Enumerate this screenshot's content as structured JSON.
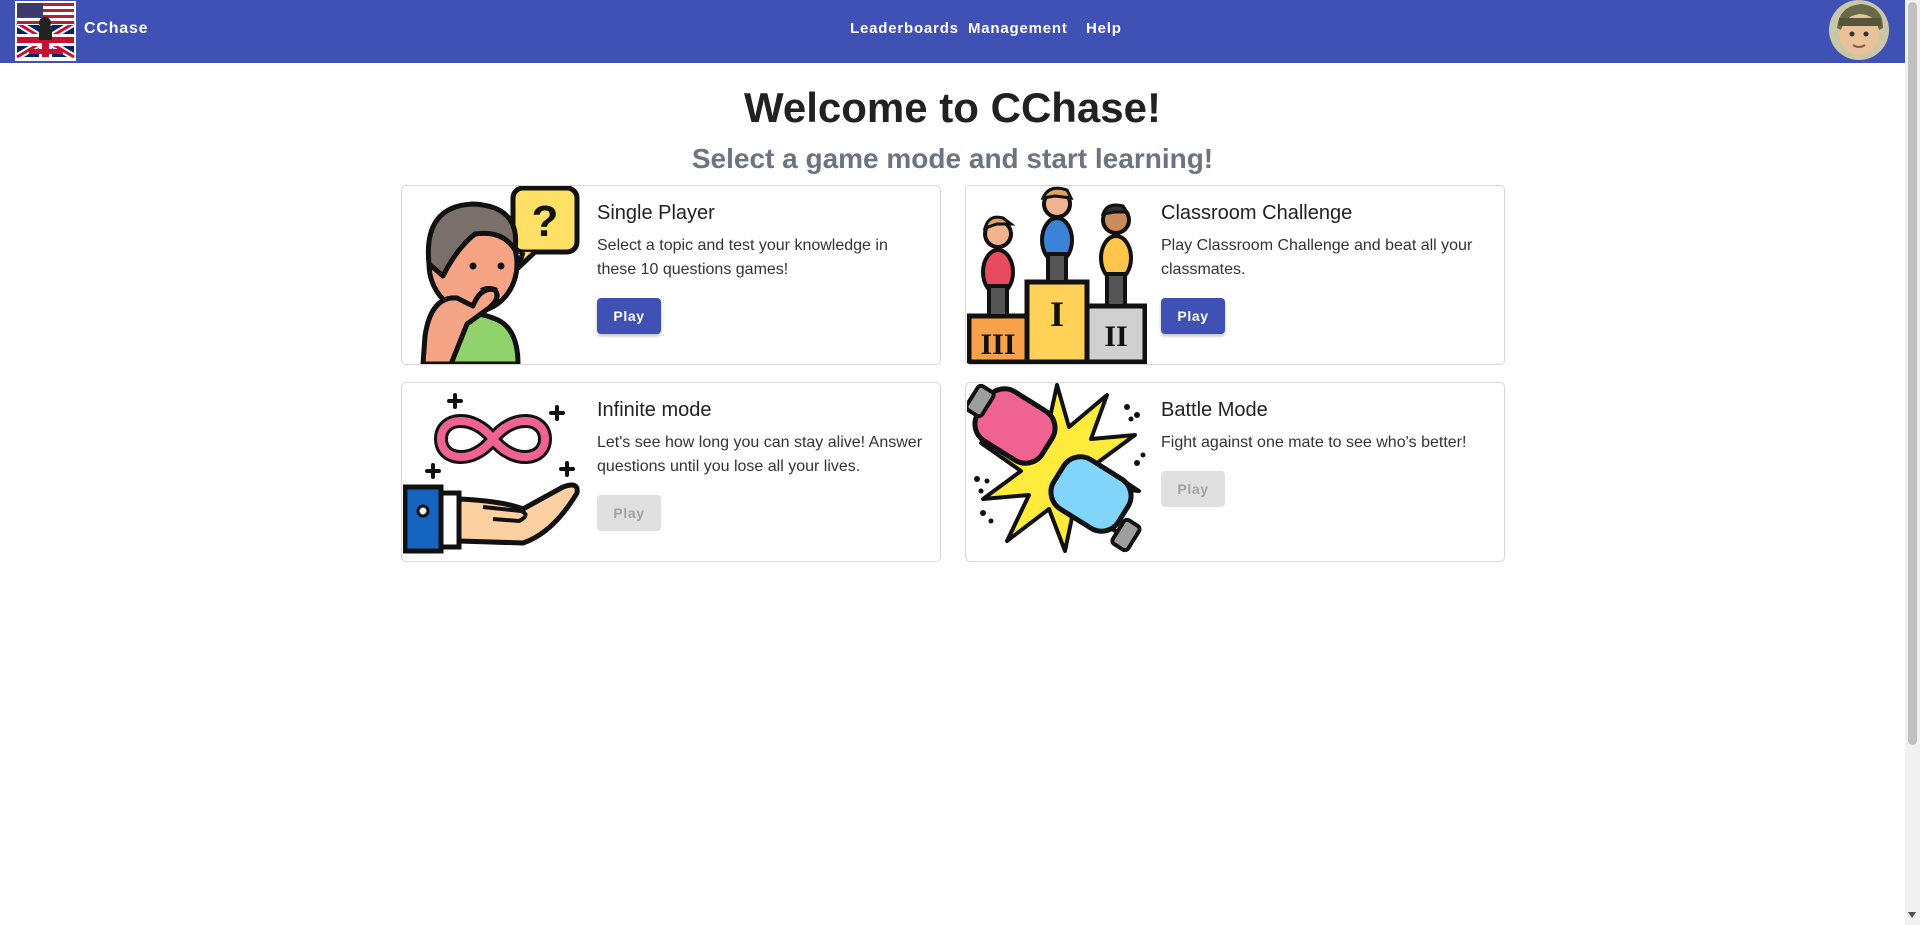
{
  "header": {
    "brand": "CChase",
    "logo_icon": "uk-us-flag-logo",
    "nav": [
      {
        "label": "Leaderboards"
      },
      {
        "label": "Management"
      },
      {
        "label": "Help"
      }
    ],
    "avatar_icon": "user-avatar",
    "colors": {
      "primary": "#3f51b5"
    }
  },
  "main": {
    "title": "Welcome to CChase!",
    "subtitle": "Select a game mode and start learning!"
  },
  "modes": [
    {
      "title": "Single Player",
      "description": "Select a topic and test your knowledge in these 10 questions games!",
      "button": "Play",
      "enabled": true,
      "icon": "thinking-boy-question-icon"
    },
    {
      "title": "Classroom Challenge",
      "description": "Play Classroom Challenge and beat all your classmates.",
      "button": "Play",
      "enabled": true,
      "icon": "podium-icon"
    },
    {
      "title": "Infinite mode",
      "description": "Let's see how long you can stay alive! Answer questions until you lose all your lives.",
      "button": "Play",
      "enabled": false,
      "icon": "infinity-hand-icon"
    },
    {
      "title": "Battle Mode",
      "description": "Fight against one mate to see who's better!",
      "button": "Play",
      "enabled": false,
      "icon": "boxing-gloves-icon"
    }
  ]
}
